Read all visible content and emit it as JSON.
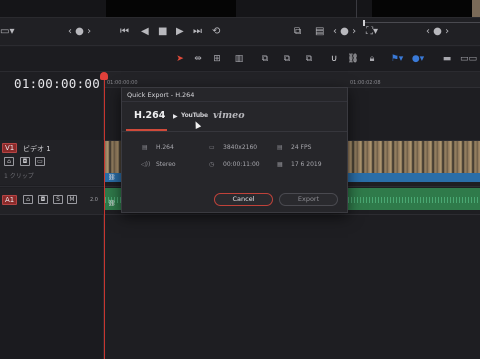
{
  "timeline": {
    "timecode": "01:00:00:00",
    "ruler_labels": [
      "01:00:00:00",
      "01:00:02:08"
    ]
  },
  "tracks": {
    "v1": {
      "badge": "V1",
      "name": "ビデオ 1",
      "clip_count": "1 クリップ"
    },
    "a1": {
      "badge": "A1",
      "solo": "S",
      "mute": "M",
      "volume": "2.0"
    }
  },
  "dialog": {
    "title": "Quick Export - H.264",
    "tabs": [
      {
        "label": "H.264",
        "active": true
      },
      {
        "label": "YouTube",
        "active": false
      },
      {
        "label": "vimeo",
        "active": false
      }
    ],
    "info": {
      "codec": "H.264",
      "resolution": "3840x2160",
      "fps": "24 FPS",
      "audio": "Stereo",
      "duration": "00:00:11:00",
      "date": "17 6 2019"
    },
    "buttons": {
      "cancel": "Cancel",
      "export": "Export"
    }
  },
  "colors": {
    "accent": "#d04a3a",
    "playhead": "#c8352f",
    "video_clip_bar": "#2a6ea8",
    "audio_clip": "#2f7a4a"
  }
}
